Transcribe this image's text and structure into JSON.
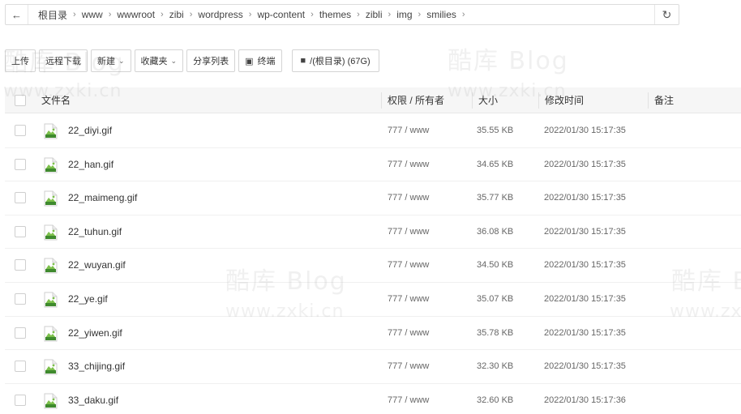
{
  "pathbar": {
    "crumbs": [
      "根目录",
      "www",
      "wwwroot",
      "zibi",
      "wordpress",
      "wp-content",
      "themes",
      "zibli",
      "img",
      "smilies"
    ]
  },
  "toolbar": {
    "upload": "上传",
    "remote_download": "远程下载",
    "new": "新建",
    "favorites": "收藏夹",
    "share_list": "分享列表",
    "terminal": "终端",
    "disk": "/(根目录) (67G)"
  },
  "table": {
    "headers": {
      "name": "文件名",
      "perm": "权限 / 所有者",
      "size": "大小",
      "mtime": "修改时间",
      "note": "备注"
    },
    "rows": [
      {
        "name": "22_diyi.gif",
        "perm": "777 / www",
        "size": "35.55 KB",
        "mtime": "2022/01/30 15:17:35"
      },
      {
        "name": "22_han.gif",
        "perm": "777 / www",
        "size": "34.65 KB",
        "mtime": "2022/01/30 15:17:35"
      },
      {
        "name": "22_maimeng.gif",
        "perm": "777 / www",
        "size": "35.77 KB",
        "mtime": "2022/01/30 15:17:35"
      },
      {
        "name": "22_tuhun.gif",
        "perm": "777 / www",
        "size": "36.08 KB",
        "mtime": "2022/01/30 15:17:35"
      },
      {
        "name": "22_wuyan.gif",
        "perm": "777 / www",
        "size": "34.50 KB",
        "mtime": "2022/01/30 15:17:35"
      },
      {
        "name": "22_ye.gif",
        "perm": "777 / www",
        "size": "35.07 KB",
        "mtime": "2022/01/30 15:17:35"
      },
      {
        "name": "22_yiwen.gif",
        "perm": "777 / www",
        "size": "35.78 KB",
        "mtime": "2022/01/30 15:17:35"
      },
      {
        "name": "33_chijing.gif",
        "perm": "777 / www",
        "size": "32.30 KB",
        "mtime": "2022/01/30 15:17:35"
      },
      {
        "name": "33_daku.gif",
        "perm": "777 / www",
        "size": "32.60 KB",
        "mtime": "2022/01/30 15:17:36"
      }
    ]
  },
  "watermark": {
    "line1": "酷库 Blog",
    "line2": "www.zxki.cn"
  },
  "colors": {
    "icon_green": "#7cc04b",
    "icon_dark_green": "#3f8a2e"
  }
}
